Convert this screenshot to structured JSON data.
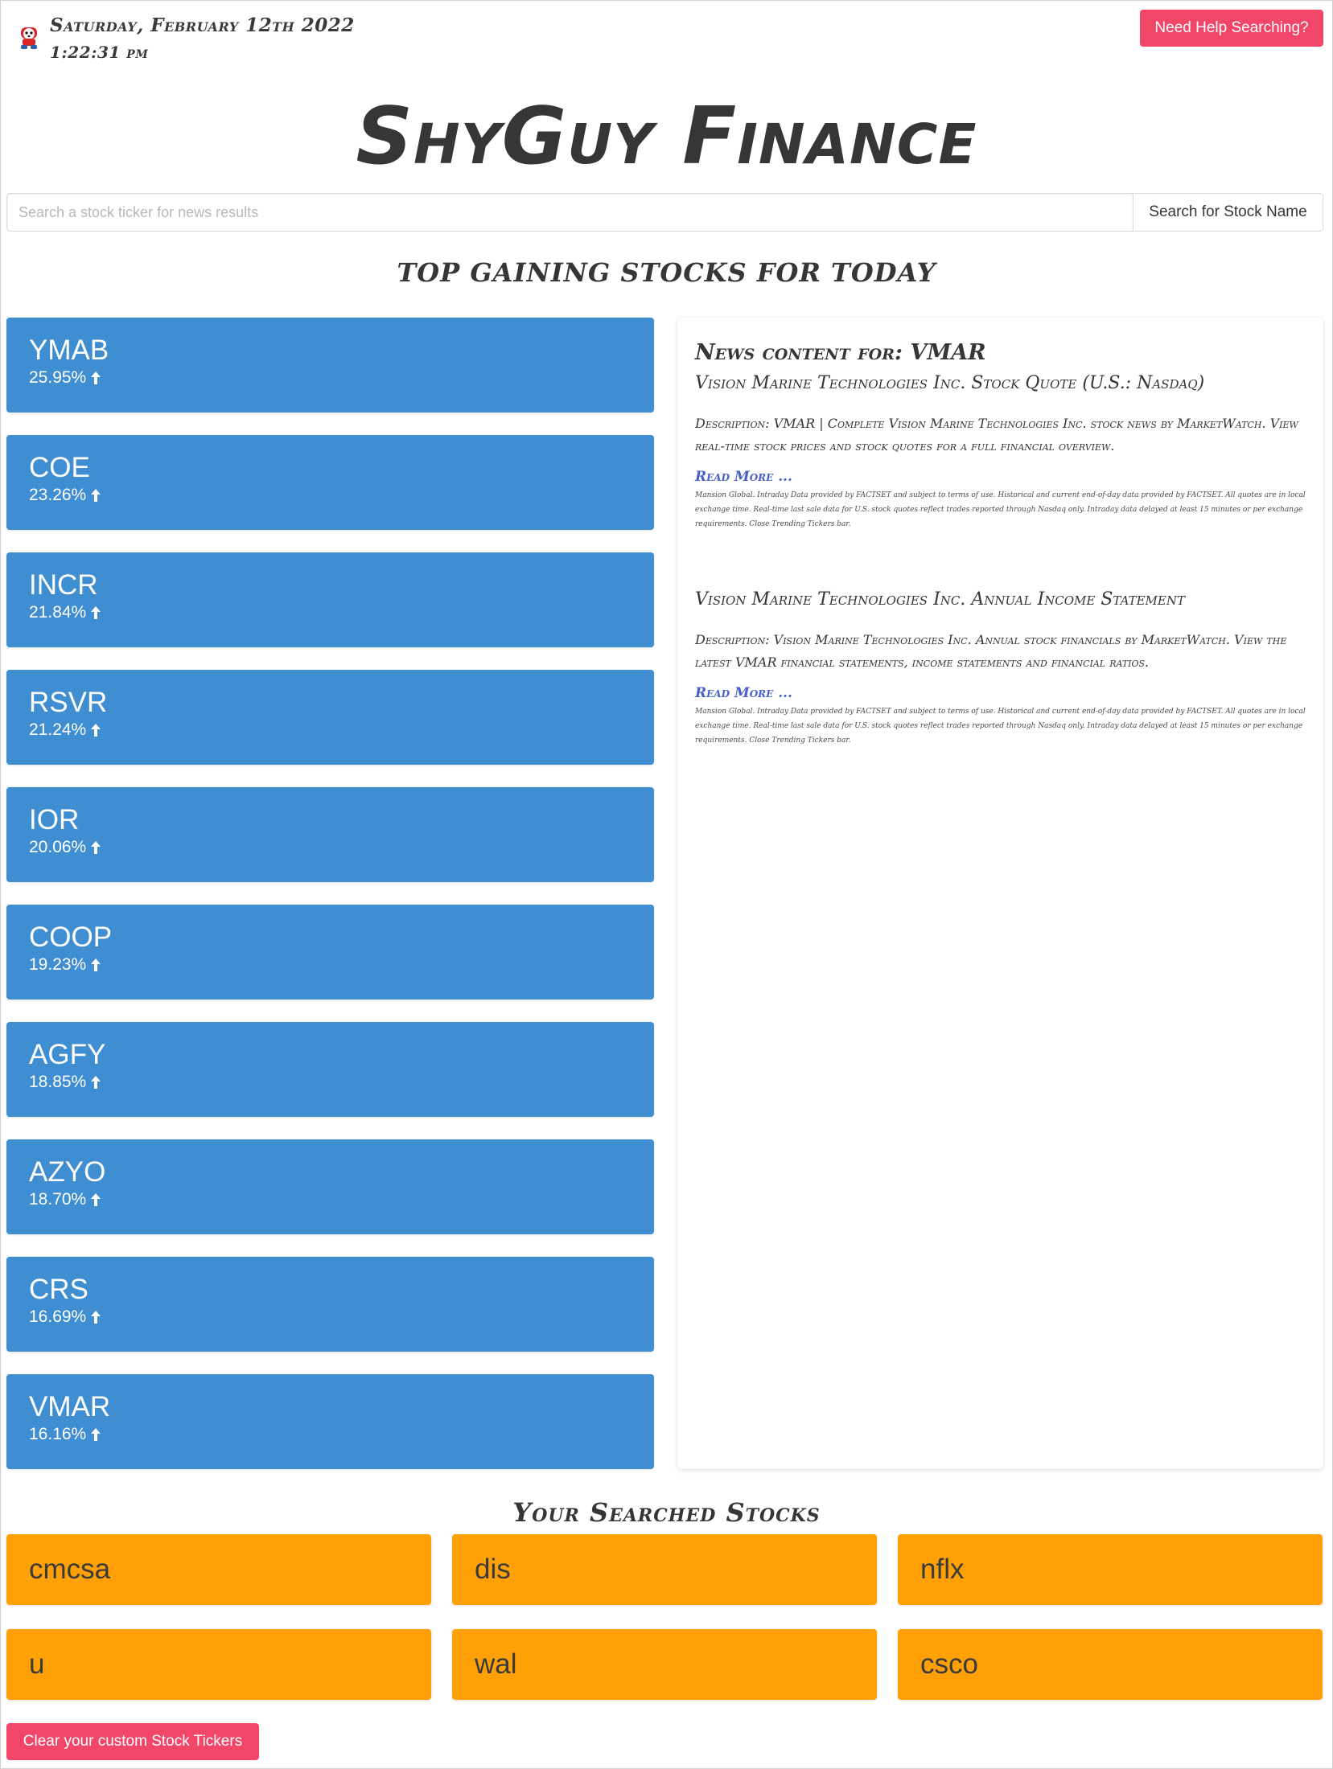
{
  "header": {
    "date": "Saturday, February 12th 2022",
    "time": "1:22:31 pm",
    "help_button": "Need Help Searching?",
    "brand": "ShyGuy Finance"
  },
  "search": {
    "placeholder": "Search a stock ticker for news results",
    "button": "Search for Stock Name"
  },
  "top_section_title": "TOP GAINING STOCKS FOR TODAY",
  "gainers": [
    {
      "ticker": "YMAB",
      "change": "25.95%"
    },
    {
      "ticker": "COE",
      "change": "23.26%"
    },
    {
      "ticker": "INCR",
      "change": "21.84%"
    },
    {
      "ticker": "RSVR",
      "change": "21.24%"
    },
    {
      "ticker": "IOR",
      "change": "20.06%"
    },
    {
      "ticker": "COOP",
      "change": "19.23%"
    },
    {
      "ticker": "AGFY",
      "change": "18.85%"
    },
    {
      "ticker": "AZYO",
      "change": "18.70%"
    },
    {
      "ticker": "CRS",
      "change": "16.69%"
    },
    {
      "ticker": "VMAR",
      "change": "16.16%"
    }
  ],
  "news": {
    "heading": "News content for: VMAR",
    "articles": [
      {
        "title": "Vision Marine Technologies Inc. Stock Quote (U.S.: Nasdaq)",
        "description": "Description: VMAR | Complete Vision Marine Technologies Inc. stock news by MarketWatch. View real-time stock prices and stock quotes for a full financial overview.",
        "read_more": "Read More ...",
        "fine_print": "Mansion Global. Intraday Data provided by FACTSET and subject to terms of use. Historical and current end-of-day data provided by FACTSET. All quotes are in local exchange time. Real-time last sale data for U.S. stock quotes reflect trades reported through Nasdaq only. Intraday data delayed at least 15 minutes or per exchange requirements. Close Trending Tickers bar."
      },
      {
        "title": "Vision Marine Technologies Inc. Annual Income Statement",
        "description": "Description: Vision Marine Technologies Inc. Annual stock financials by MarketWatch. View the latest VMAR financial statements, income statements and financial ratios.",
        "read_more": "Read More ...",
        "fine_print": "Mansion Global. Intraday Data provided by FACTSET and subject to terms of use. Historical and current end-of-day data provided by FACTSET. All quotes are in local exchange time. Real-time last sale data for U.S. stock quotes reflect trades reported through Nasdaq only. Intraday data delayed at least 15 minutes or per exchange requirements. Close Trending Tickers bar."
      }
    ]
  },
  "searched_title": "Your Searched Stocks",
  "searched": [
    "cmcsa",
    "dis",
    "nflx",
    "u",
    "wal",
    "csco"
  ],
  "clear_button": "Clear your custom Stock Tickers",
  "colors": {
    "gainer_card": "#3f8ed1",
    "saved_card": "#ffa106",
    "danger_button": "#f14668",
    "link": "#485fc7"
  }
}
